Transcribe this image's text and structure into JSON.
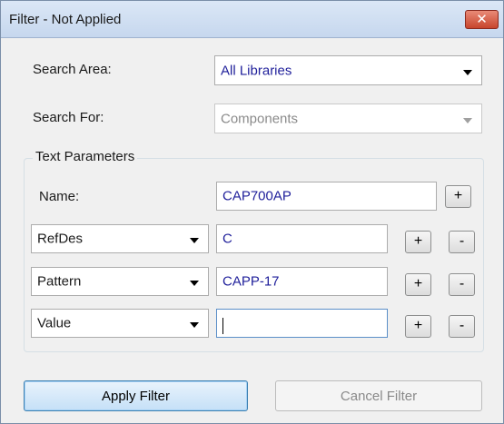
{
  "window": {
    "title": "Filter - Not Applied",
    "close_glyph": "✕"
  },
  "search_area": {
    "label": "Search Area:",
    "value": "All Libraries"
  },
  "search_for": {
    "label": "Search For:",
    "value": "Components"
  },
  "text_parameters": {
    "title": "Text Parameters",
    "name_row": {
      "label": "Name:",
      "value": "CAP700AP",
      "add_label": "+"
    },
    "rows": [
      {
        "field": "RefDes",
        "value": "C",
        "add_label": "+",
        "remove_label": "-"
      },
      {
        "field": "Pattern",
        "value": "CAPP-17",
        "add_label": "+",
        "remove_label": "-"
      },
      {
        "field": "Value",
        "value": "",
        "add_label": "+",
        "remove_label": "-"
      }
    ]
  },
  "buttons": {
    "apply": "Apply Filter",
    "cancel": "Cancel Filter"
  },
  "colors": {
    "value_text": "#1e1e9a",
    "title_bar": "#c6d7ee",
    "close_button": "#c7452d"
  }
}
